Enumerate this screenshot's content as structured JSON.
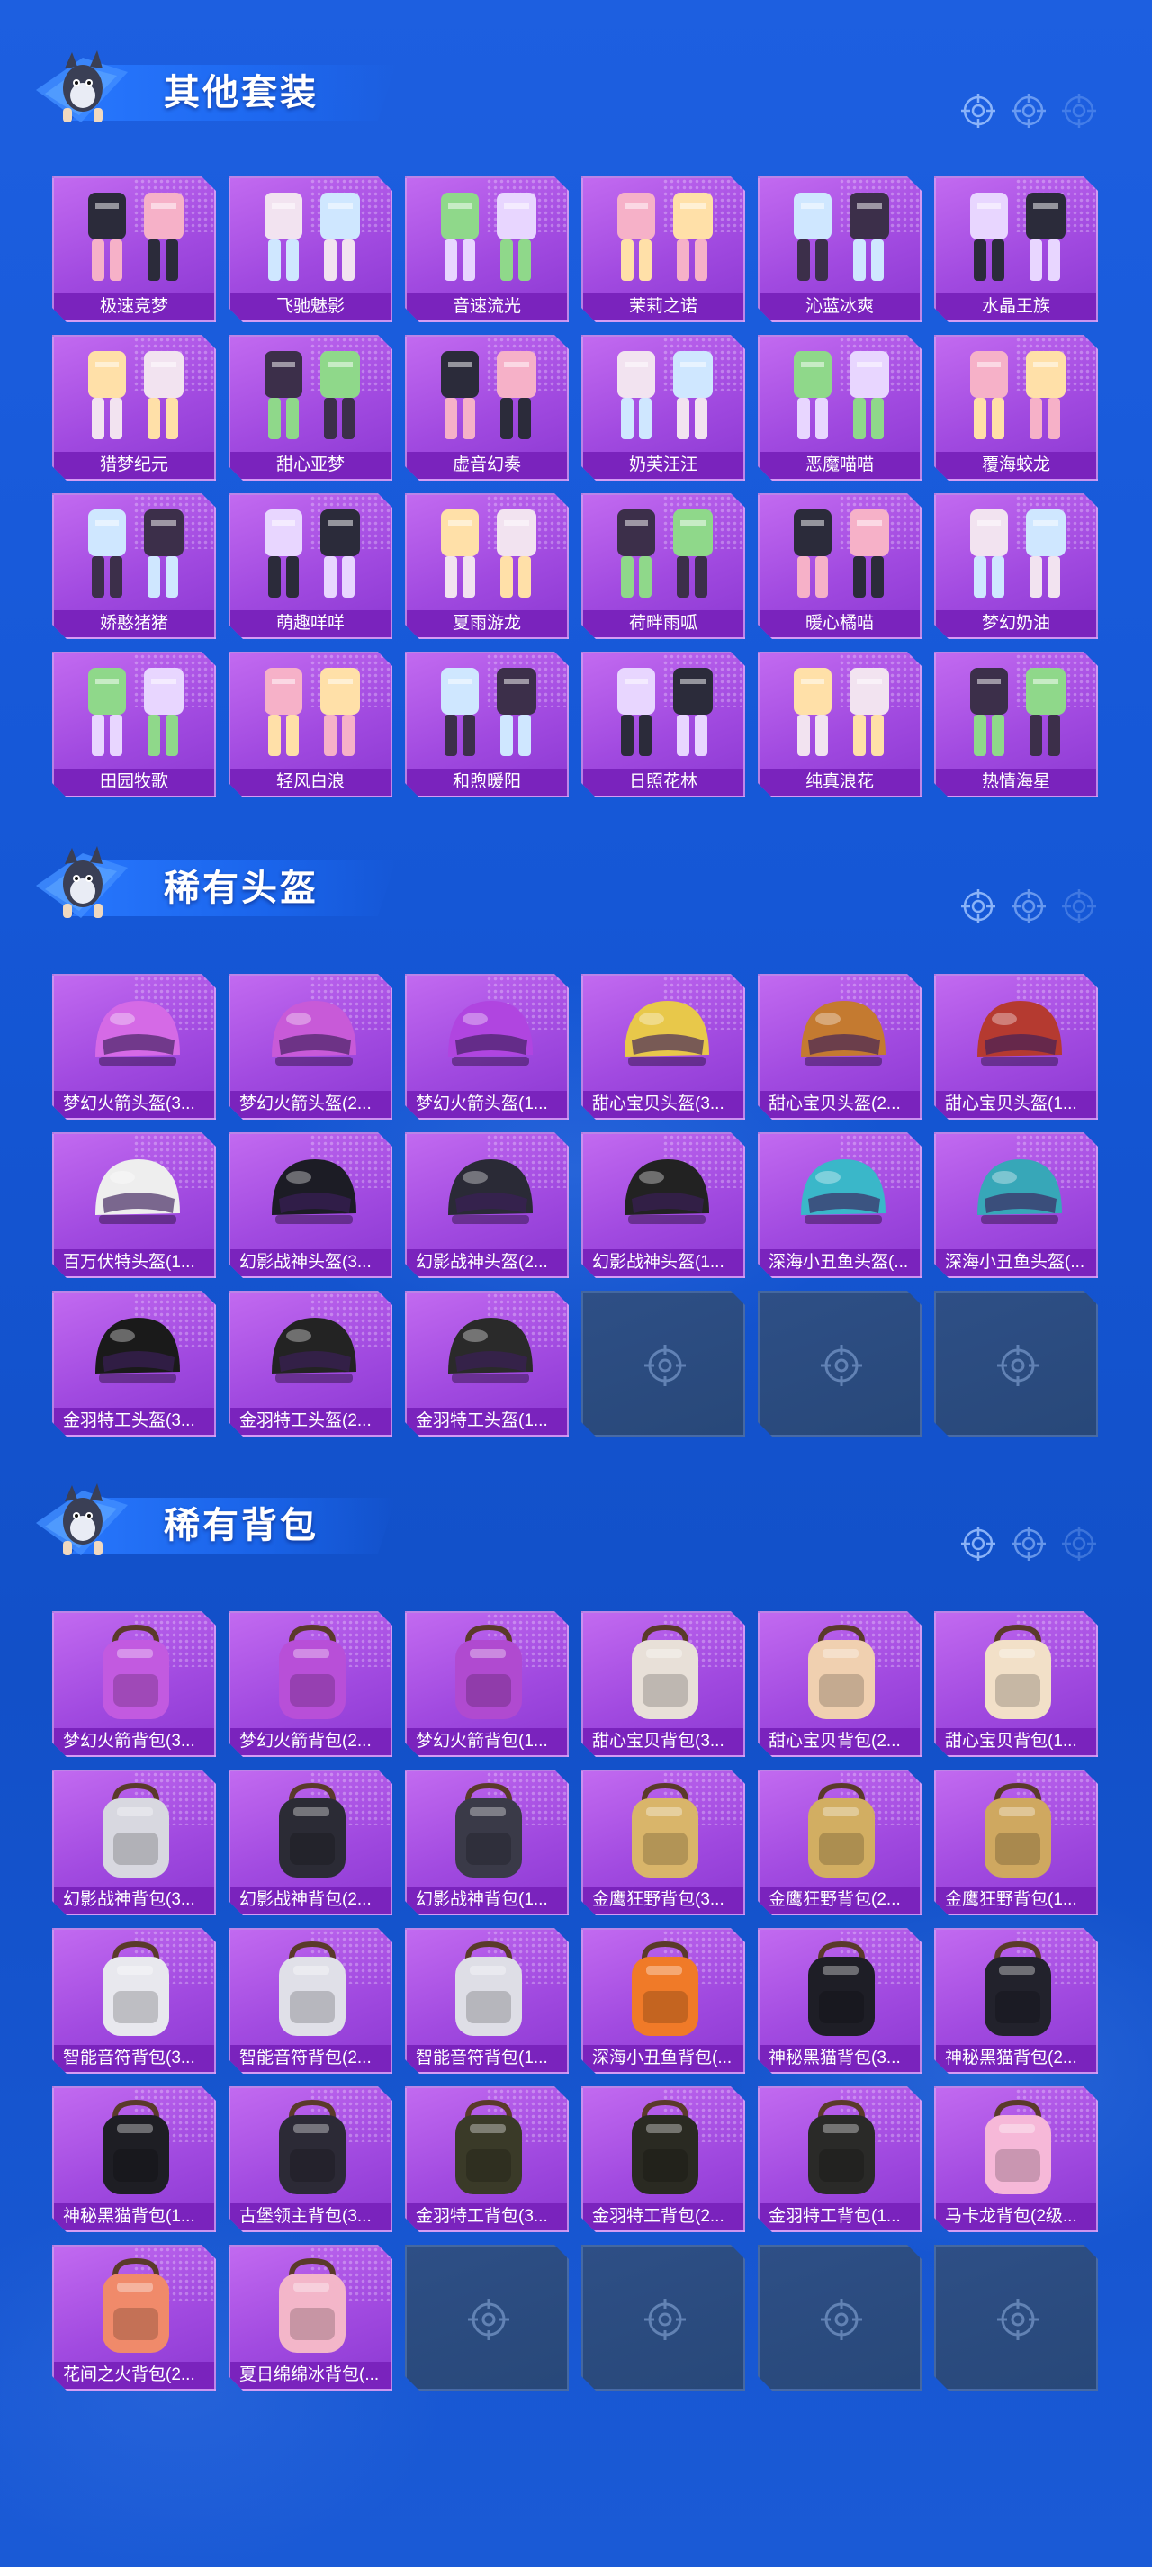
{
  "sections": [
    {
      "title": "其他套装",
      "align": "center",
      "items": [
        "极速竞梦",
        "飞驰魅影",
        "音速流光",
        "茉莉之诺",
        "沁蓝冰爽",
        "水晶王族",
        "猎梦纪元",
        "甜心亚梦",
        "虚音幻奏",
        "奶芙汪汪",
        "恶魔喵喵",
        "覆海蛟龙",
        "娇憨猪猪",
        "萌趣咩咩",
        "夏雨游龙",
        "荷畔雨呱",
        "暖心橘喵",
        "梦幻奶油",
        "田园牧歌",
        "轻风白浪",
        "和煦暖阳",
        "日照花林",
        "纯真浪花",
        "热情海星"
      ],
      "empty_slots": 0,
      "art": "outfit"
    },
    {
      "title": "稀有头盔",
      "align": "left",
      "items": [
        "梦幻火箭头盔(3...",
        "梦幻火箭头盔(2...",
        "梦幻火箭头盔(1...",
        "甜心宝贝头盔(3...",
        "甜心宝贝头盔(2...",
        "甜心宝贝头盔(1...",
        "百万伏特头盔(1...",
        "幻影战神头盔(3...",
        "幻影战神头盔(2...",
        "幻影战神头盔(1...",
        "深海小丑鱼头盔(...",
        "深海小丑鱼头盔(...",
        "金羽特工头盔(3...",
        "金羽特工头盔(2...",
        "金羽特工头盔(1..."
      ],
      "empty_slots": 3,
      "art": "helmet"
    },
    {
      "title": "稀有背包",
      "align": "left",
      "items": [
        "梦幻火箭背包(3...",
        "梦幻火箭背包(2...",
        "梦幻火箭背包(1...",
        "甜心宝贝背包(3...",
        "甜心宝贝背包(2...",
        "甜心宝贝背包(1...",
        "幻影战神背包(3...",
        "幻影战神背包(2...",
        "幻影战神背包(1...",
        "金鹰狂野背包(3...",
        "金鹰狂野背包(2...",
        "金鹰狂野背包(1...",
        "智能音符背包(3...",
        "智能音符背包(2...",
        "智能音符背包(1...",
        "深海小丑鱼背包(...",
        "神秘黑猫背包(3...",
        "神秘黑猫背包(2...",
        "神秘黑猫背包(1...",
        "古堡领主背包(3...",
        "金羽特工背包(3...",
        "金羽特工背包(2...",
        "金羽特工背包(1...",
        "马卡龙背包(2级...",
        "花间之火背包(2...",
        "夏日绵绵冰背包(..."
      ],
      "empty_slots": 4,
      "art": "backpack"
    }
  ],
  "colors": {
    "card_top": "#c26af0",
    "label_bar": "#7a23bd",
    "empty_card": "#2e4f86",
    "background": "#1557d6"
  },
  "icons": [
    "mascot-icon",
    "crosshair-icon",
    "empty-slot-icon"
  ]
}
